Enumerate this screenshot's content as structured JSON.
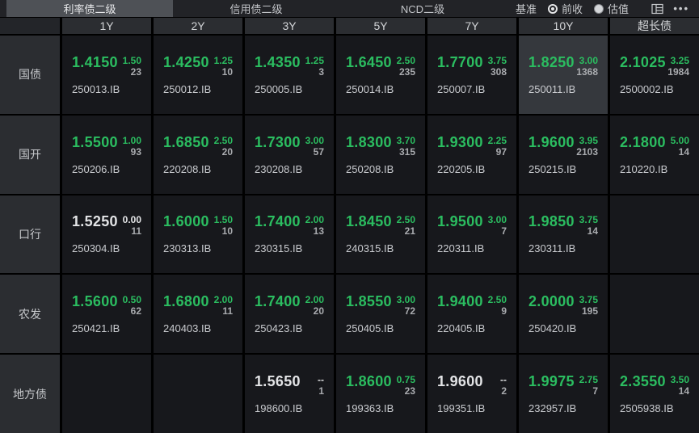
{
  "tabs": [
    {
      "label": "利率债二级",
      "selected": true
    },
    {
      "label": "信用债二级",
      "selected": false
    },
    {
      "label": "NCD二级",
      "selected": false
    }
  ],
  "benchmark": {
    "label": "基准",
    "options": [
      {
        "label": "前收",
        "selected": true
      },
      {
        "label": "估值",
        "selected": false
      }
    ]
  },
  "icons": {
    "layout": "layout-panel-icon",
    "more": "more-icon"
  },
  "colors": {
    "up_green": "#2bbd60",
    "flat_white": "#e3e4e6",
    "cell_bg": "#17181c",
    "highlight_bg": "#35383d"
  },
  "columns": [
    "1Y",
    "2Y",
    "3Y",
    "5Y",
    "7Y",
    "10Y",
    "超长债"
  ],
  "rows": [
    {
      "label": "国债",
      "cells": [
        {
          "value": "1.4150",
          "change": "1.50",
          "count": "23",
          "code": "250013.IB",
          "tone": "up"
        },
        {
          "value": "1.4250",
          "change": "1.25",
          "count": "10",
          "code": "250012.IB",
          "tone": "up"
        },
        {
          "value": "1.4350",
          "change": "1.25",
          "count": "3",
          "code": "250005.IB",
          "tone": "up"
        },
        {
          "value": "1.6450",
          "change": "2.50",
          "count": "235",
          "code": "250014.IB",
          "tone": "up"
        },
        {
          "value": "1.7700",
          "change": "3.75",
          "count": "308",
          "code": "250007.IB",
          "tone": "up"
        },
        {
          "value": "1.8250",
          "change": "3.00",
          "count": "1368",
          "code": "250011.IB",
          "tone": "up",
          "highlight": true
        },
        {
          "value": "2.1025",
          "change": "3.25",
          "count": "1984",
          "code": "2500002.IB",
          "tone": "up"
        }
      ]
    },
    {
      "label": "国开",
      "cells": [
        {
          "value": "1.5500",
          "change": "1.00",
          "count": "93",
          "code": "250206.IB",
          "tone": "up"
        },
        {
          "value": "1.6850",
          "change": "2.50",
          "count": "20",
          "code": "220208.IB",
          "tone": "up"
        },
        {
          "value": "1.7300",
          "change": "3.00",
          "count": "57",
          "code": "230208.IB",
          "tone": "up"
        },
        {
          "value": "1.8300",
          "change": "3.70",
          "count": "315",
          "code": "250208.IB",
          "tone": "up"
        },
        {
          "value": "1.9300",
          "change": "2.25",
          "count": "97",
          "code": "220205.IB",
          "tone": "up"
        },
        {
          "value": "1.9600",
          "change": "3.95",
          "count": "2103",
          "code": "250215.IB",
          "tone": "up"
        },
        {
          "value": "2.1800",
          "change": "5.00",
          "count": "14",
          "code": "210220.IB",
          "tone": "up"
        }
      ]
    },
    {
      "label": "口行",
      "cells": [
        {
          "value": "1.5250",
          "change": "0.00",
          "count": "11",
          "code": "250304.IB",
          "tone": "flat"
        },
        {
          "value": "1.6000",
          "change": "1.50",
          "count": "10",
          "code": "230313.IB",
          "tone": "up"
        },
        {
          "value": "1.7400",
          "change": "2.00",
          "count": "13",
          "code": "230315.IB",
          "tone": "up"
        },
        {
          "value": "1.8450",
          "change": "2.50",
          "count": "21",
          "code": "240315.IB",
          "tone": "up"
        },
        {
          "value": "1.9500",
          "change": "3.00",
          "count": "7",
          "code": "220311.IB",
          "tone": "up"
        },
        {
          "value": "1.9850",
          "change": "3.75",
          "count": "14",
          "code": "230311.IB",
          "tone": "up"
        },
        null
      ]
    },
    {
      "label": "农发",
      "cells": [
        {
          "value": "1.5600",
          "change": "0.50",
          "count": "62",
          "code": "250421.IB",
          "tone": "up"
        },
        {
          "value": "1.6800",
          "change": "2.00",
          "count": "11",
          "code": "240403.IB",
          "tone": "up"
        },
        {
          "value": "1.7400",
          "change": "2.00",
          "count": "20",
          "code": "250423.IB",
          "tone": "up"
        },
        {
          "value": "1.8550",
          "change": "3.00",
          "count": "72",
          "code": "250405.IB",
          "tone": "up"
        },
        {
          "value": "1.9400",
          "change": "2.50",
          "count": "9",
          "code": "220405.IB",
          "tone": "up"
        },
        {
          "value": "2.0000",
          "change": "3.75",
          "count": "195",
          "code": "250420.IB",
          "tone": "up"
        },
        null
      ]
    },
    {
      "label": "地方债",
      "cells": [
        null,
        null,
        {
          "value": "1.5650",
          "change": "--",
          "count": "1",
          "code": "198600.IB",
          "tone": "flat"
        },
        {
          "value": "1.8600",
          "change": "0.75",
          "count": "23",
          "code": "199363.IB",
          "tone": "up"
        },
        {
          "value": "1.9600",
          "change": "--",
          "count": "2",
          "code": "199351.IB",
          "tone": "flat"
        },
        {
          "value": "1.9975",
          "change": "2.75",
          "count": "7",
          "code": "232957.IB",
          "tone": "up"
        },
        {
          "value": "2.3550",
          "change": "3.50",
          "count": "14",
          "code": "2505938.IB",
          "tone": "up"
        }
      ]
    }
  ]
}
